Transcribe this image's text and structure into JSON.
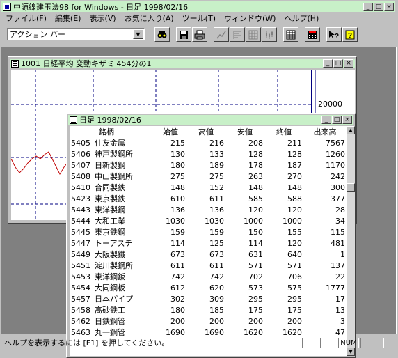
{
  "app": {
    "title": "中源線建玉法98 for Windows - 日足  1998/02/16",
    "caption_min": "_",
    "caption_max": "□",
    "caption_close": "×"
  },
  "menu": [
    "ファイル(F)",
    "編集(E)",
    "表示(V)",
    "お気に入り(A)",
    "ツール(T)",
    "ウィンドウ(W)",
    "ヘルプ(H)"
  ],
  "toolbar": {
    "action_bar_value": "アクション バー",
    "dropdown_arrow": "▼",
    "buttons": [
      "binoculars-icon",
      "save-icon",
      "print-icon",
      "line-chart-icon",
      "bar-list-icon",
      "grid-icon",
      "candlestick-icon",
      "table-icon",
      "calculator-icon",
      "help-cursor-icon",
      "help-icon"
    ]
  },
  "chart_window": {
    "title": "1001  日経平均  変動キザミ  454分の1",
    "price_label": "20000"
  },
  "list_window": {
    "title": "日足  1998/02/16",
    "columns": [
      "銘柄",
      "",
      "始値",
      "高値",
      "安値",
      "終値",
      "出来高"
    ],
    "rows": [
      [
        "5405",
        "住友金属",
        "215",
        "216",
        "208",
        "211",
        "7567"
      ],
      [
        "5406",
        "神戸製鋼所",
        "130",
        "133",
        "128",
        "128",
        "1260"
      ],
      [
        "5407",
        "日新製鋼",
        "180",
        "189",
        "178",
        "187",
        "1170"
      ],
      [
        "5408",
        "中山製鋼所",
        "275",
        "275",
        "263",
        "270",
        "242"
      ],
      [
        "5410",
        "合同製鉄",
        "148",
        "152",
        "148",
        "148",
        "300"
      ],
      [
        "5423",
        "東京製鉄",
        "610",
        "611",
        "585",
        "588",
        "377"
      ],
      [
        "5443",
        "東洋製鋼",
        "136",
        "136",
        "120",
        "120",
        "28"
      ],
      [
        "5444",
        "大和工業",
        "1030",
        "1030",
        "1000",
        "1000",
        "34"
      ],
      [
        "5445",
        "東京鉄鋼",
        "159",
        "159",
        "150",
        "155",
        "115"
      ],
      [
        "5447",
        "トーアスチ",
        "114",
        "125",
        "114",
        "120",
        "481"
      ],
      [
        "5449",
        "大阪製鐵",
        "673",
        "673",
        "631",
        "640",
        "1"
      ],
      [
        "5451",
        "淀川製鋼所",
        "611",
        "611",
        "571",
        "571",
        "137"
      ],
      [
        "5453",
        "東洋鋼鈑",
        "742",
        "742",
        "702",
        "706",
        "22"
      ],
      [
        "5454",
        "大同鋼板",
        "612",
        "620",
        "573",
        "575",
        "1777"
      ],
      [
        "5457",
        "日本パイプ",
        "302",
        "309",
        "295",
        "295",
        "17"
      ],
      [
        "5458",
        "高砂鉄工",
        "180",
        "185",
        "175",
        "175",
        "13"
      ],
      [
        "5462",
        "日鉄鋼管",
        "200",
        "200",
        "200",
        "200",
        "3"
      ],
      [
        "5463",
        "丸一鋼管",
        "1690",
        "1690",
        "1620",
        "1620",
        "47"
      ]
    ]
  },
  "status": {
    "text": "ヘルプを表示するには [F1] を押してください。",
    "num": "NUM"
  }
}
